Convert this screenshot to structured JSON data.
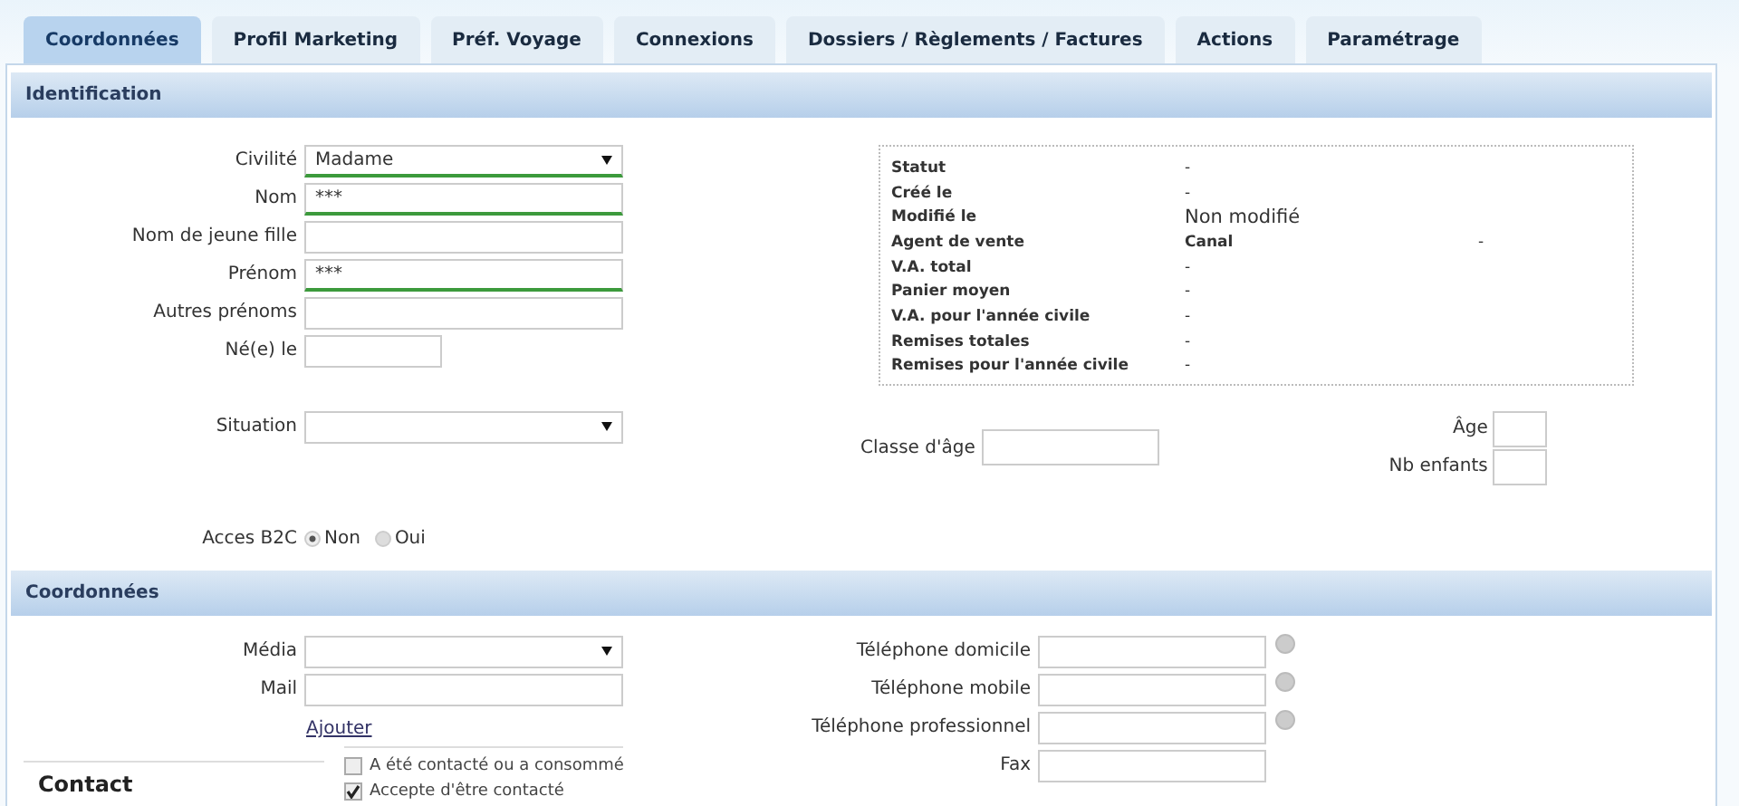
{
  "tabs": [
    {
      "label": "Coordonnées",
      "selected": true
    },
    {
      "label": "Profil Marketing",
      "selected": false
    },
    {
      "label": "Préf. Voyage",
      "selected": false
    },
    {
      "label": "Connexions",
      "selected": false
    },
    {
      "label": "Dossiers / Règlements / Factures",
      "selected": false
    },
    {
      "label": "Actions",
      "selected": false
    },
    {
      "label": "Paramétrage",
      "selected": false
    }
  ],
  "identification": {
    "title": "Identification",
    "fields": [
      {
        "label": "Civilité",
        "kind": "select",
        "value": "Madame",
        "required": true
      },
      {
        "label": "Nom",
        "kind": "text",
        "value": "***",
        "required": true
      },
      {
        "label": "Nom de jeune fille",
        "kind": "text",
        "required": false
      },
      {
        "label": "Prénom",
        "kind": "text",
        "value": "***",
        "required": true
      },
      {
        "label": "Autres prénoms",
        "kind": "text",
        "required": false
      },
      {
        "label": "Né(e) le",
        "kind": "date",
        "required": false
      }
    ],
    "info": [
      {
        "label": "Statut",
        "value": "-",
        "kind": "dash"
      },
      {
        "label": "Créé le",
        "value": "-",
        "kind": "dash"
      },
      {
        "label": "Modifié le",
        "value": "Non modifié",
        "kind": "text"
      },
      {
        "label": "Agent de vente",
        "value": "Canal",
        "extra": "-",
        "kind": "bold"
      },
      {
        "label": "V.A. total",
        "value": "-",
        "kind": "dash"
      },
      {
        "label": "Panier moyen",
        "value": "-",
        "kind": "dash"
      },
      {
        "label": "V.A. pour l'année civile",
        "value": "-",
        "kind": "dash"
      },
      {
        "label": "Remises totales",
        "value": "-",
        "kind": "dash"
      },
      {
        "label": "Remises pour l'année civile",
        "value": "-",
        "kind": "dash"
      }
    ],
    "situation": {
      "label": "Situation",
      "kind": "select"
    },
    "classe_age": {
      "label": "Classe d'âge"
    },
    "age": {
      "label": "Âge"
    },
    "nb_enfants": {
      "label": "Nb enfants"
    },
    "acces_b2c": {
      "label": "Acces B2C",
      "options": [
        {
          "label": "Non",
          "selected": true
        },
        {
          "label": "Oui",
          "selected": false
        }
      ]
    }
  },
  "coordonnees": {
    "title": "Coordonnées",
    "fields": [
      {
        "label": "Média",
        "kind": "select"
      },
      {
        "label": "Mail",
        "kind": "text"
      }
    ],
    "add_link": "Ajouter",
    "phones": [
      {
        "label": "Téléphone domicile",
        "status": true
      },
      {
        "label": "Téléphone mobile",
        "status": true
      },
      {
        "label": "Téléphone professionnel",
        "status": true
      },
      {
        "label": "Fax",
        "status": false
      }
    ],
    "contact_tab": "Contact",
    "checkboxes": [
      {
        "label": "A été contacté ou a consommé",
        "checked": false
      },
      {
        "label": "Accepte d'être contacté",
        "checked": true
      }
    ]
  }
}
